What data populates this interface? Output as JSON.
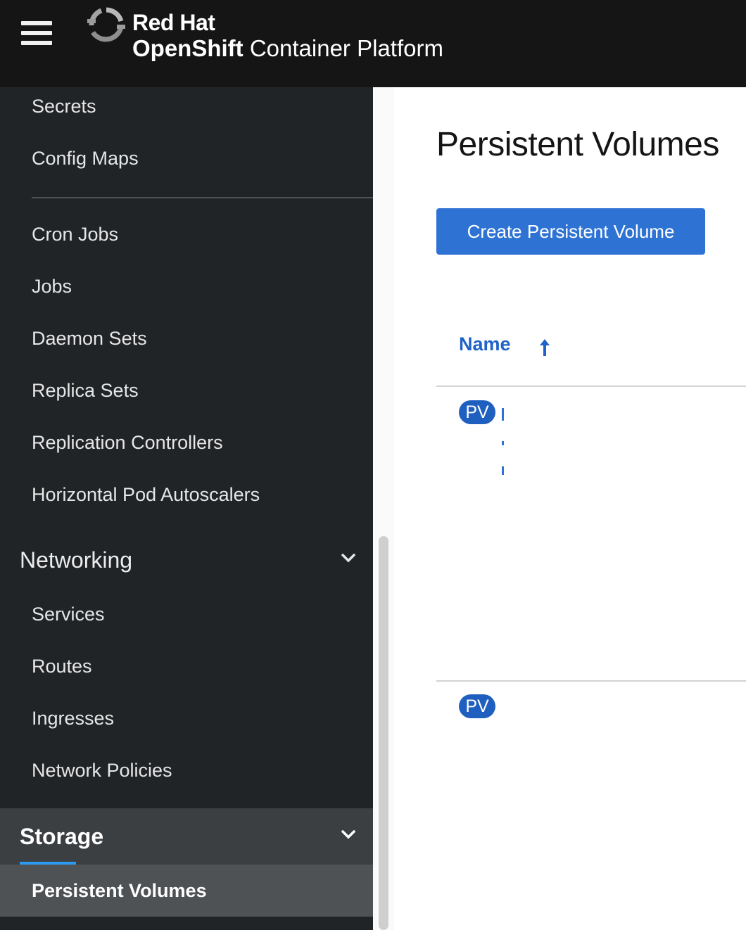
{
  "masthead": {
    "brand_line1": "Red Hat",
    "brand_line2_bold": "OpenShift",
    "brand_line2_rest": " Container Platform",
    "menu_icon": "hamburger-icon",
    "logo_icon": "redhat-openshift-logo"
  },
  "sidebar": {
    "workloads_items": [
      {
        "label": "Secrets"
      },
      {
        "label": "Config Maps"
      },
      {
        "label": "Cron Jobs"
      },
      {
        "label": "Jobs"
      },
      {
        "label": "Daemon Sets"
      },
      {
        "label": "Replica Sets"
      },
      {
        "label": "Replication Controllers"
      },
      {
        "label": "Horizontal Pod Autoscalers"
      }
    ],
    "networking": {
      "label": "Networking",
      "items": [
        {
          "label": "Services"
        },
        {
          "label": "Routes"
        },
        {
          "label": "Ingresses"
        },
        {
          "label": "Network Policies"
        }
      ]
    },
    "storage": {
      "label": "Storage",
      "items": [
        {
          "label": "Persistent Volumes"
        }
      ]
    }
  },
  "main": {
    "title": "Persistent Volumes",
    "create_button": "Create Persistent Volume",
    "table": {
      "column_name": "Name",
      "rows": [
        {
          "badge": "PV"
        },
        {
          "badge": "PV"
        }
      ]
    }
  },
  "colors": {
    "masthead_bg": "#151515",
    "sidebar_bg": "#212427",
    "primary_blue": "#2e73d4",
    "link_blue": "#1f62c8",
    "active_underline": "#2b9af3"
  }
}
